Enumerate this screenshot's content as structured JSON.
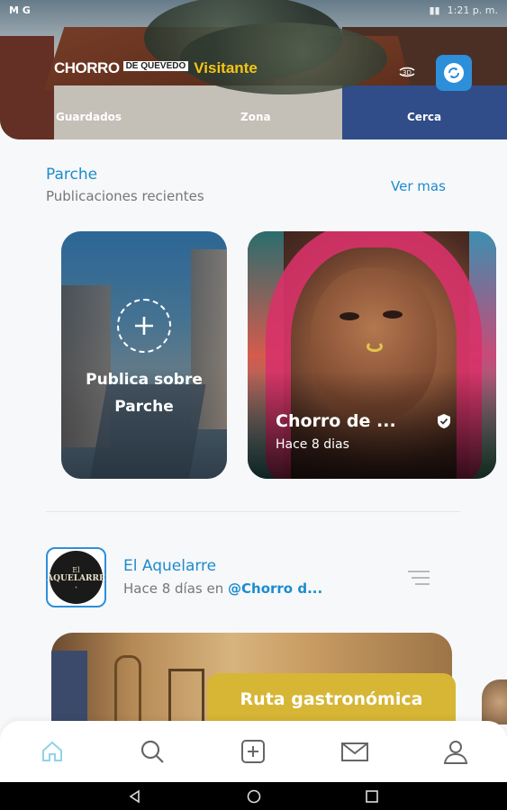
{
  "status_bar": {
    "left": "M G",
    "time": "1:21 p. m."
  },
  "header": {
    "brand_main": "CHORRO",
    "brand_small": "DE QUEVEDO",
    "brand_role": "Visitante",
    "nav": [
      "Guardados",
      "Zona",
      "Cerca"
    ]
  },
  "section": {
    "title": "Parche",
    "subtitle": "Publicaciones recientes",
    "see_more": "Ver mas"
  },
  "publish_card": {
    "label_line1": "Publica sobre",
    "label_line2": "Parche"
  },
  "post_card": {
    "title": "Chorro de ...",
    "time": "Hace 8 dias"
  },
  "feed_item": {
    "avatar_line1": "El",
    "avatar_line2": "AQUELARRE",
    "name": "El Aquelarre",
    "meta_prefix": "Hace 8 días en",
    "mention": "@Chorro d...",
    "route_label": "Ruta gastronómica"
  },
  "tabbar": [
    "home-icon",
    "search-icon",
    "add-post-icon",
    "mail-icon",
    "profile-icon"
  ],
  "colors": {
    "accent": "#1d8ccc",
    "brand_yellow": "#f5c518",
    "route_gold": "#d6b634",
    "sync_blue": "#2d8fd9"
  }
}
